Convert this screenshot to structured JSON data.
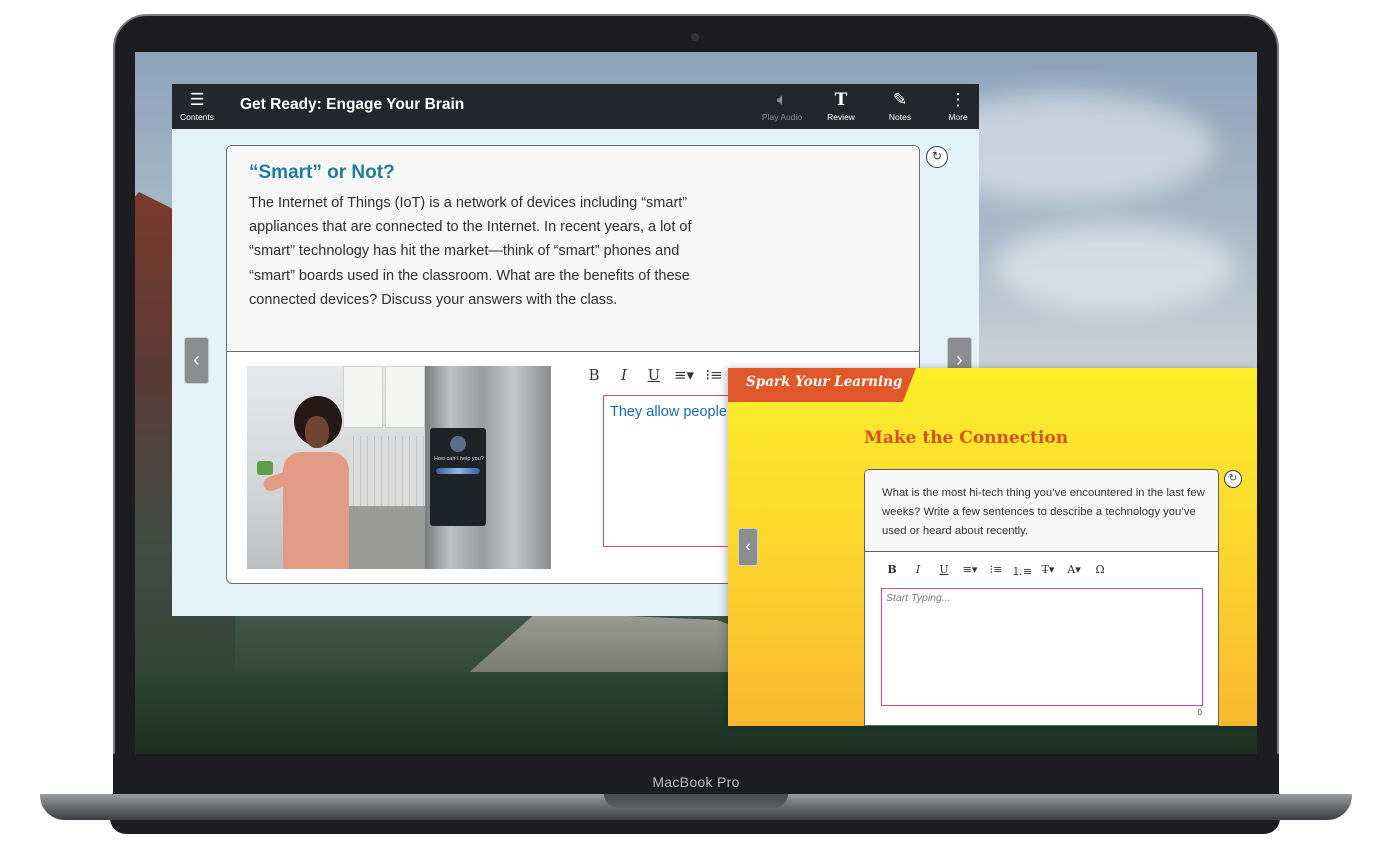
{
  "device": {
    "label": "MacBook Pro"
  },
  "app": {
    "title": "Get Ready: Engage Your Brain",
    "toolbar": {
      "contents": {
        "label": "Contents",
        "icon": "hamburger-icon"
      },
      "play_audio": {
        "label": "Play Audio",
        "icon": "speaker-icon",
        "disabled": true
      },
      "review": {
        "label": "Review",
        "icon": "text-icon"
      },
      "notes": {
        "label": "Notes",
        "icon": "edit-icon"
      },
      "more": {
        "label": "More",
        "icon": "kebab-icon"
      }
    }
  },
  "lesson_card": {
    "title": "“Smart” or Not?",
    "body": "The Internet of Things (IoT) is a network of devices including “smart” appliances that are connected to the Internet. In recent years, a lot of “smart” technology has hit the market—think of “smart” phones and “smart” boards used in the classroom. What are the benefits of these connected devices? Discuss your answers with the class.",
    "fridge_screen_text": "How can I help you?",
    "answer_text": "They allow people to stay connected."
  },
  "editor_toolbar": [
    "B",
    "I",
    "U",
    "≡▾",
    "⁝≡"
  ],
  "spark_panel": {
    "tab_label": "Spark Your Learning",
    "title": "Make the Connection",
    "question": "What is the most hi-tech thing you’ve encountered in the last few weeks? Write a few sentences to describe a technology you’ve used or heard about recently.",
    "toolbar": [
      "B",
      "I",
      "U",
      "≡▾",
      "⁝≡",
      "⒈≡",
      "T̶▾",
      "A▾",
      "Ω"
    ],
    "input_placeholder": "Start Typing...",
    "char_count": "0"
  },
  "colors": {
    "topbar": "#23262a",
    "title_teal": "#1e7e97",
    "answer_blue": "#1a6ab0",
    "input_border_magenta": "#c94aa0",
    "spark_orange": "#e0582a",
    "spark_yellow": "#fbee2a"
  }
}
